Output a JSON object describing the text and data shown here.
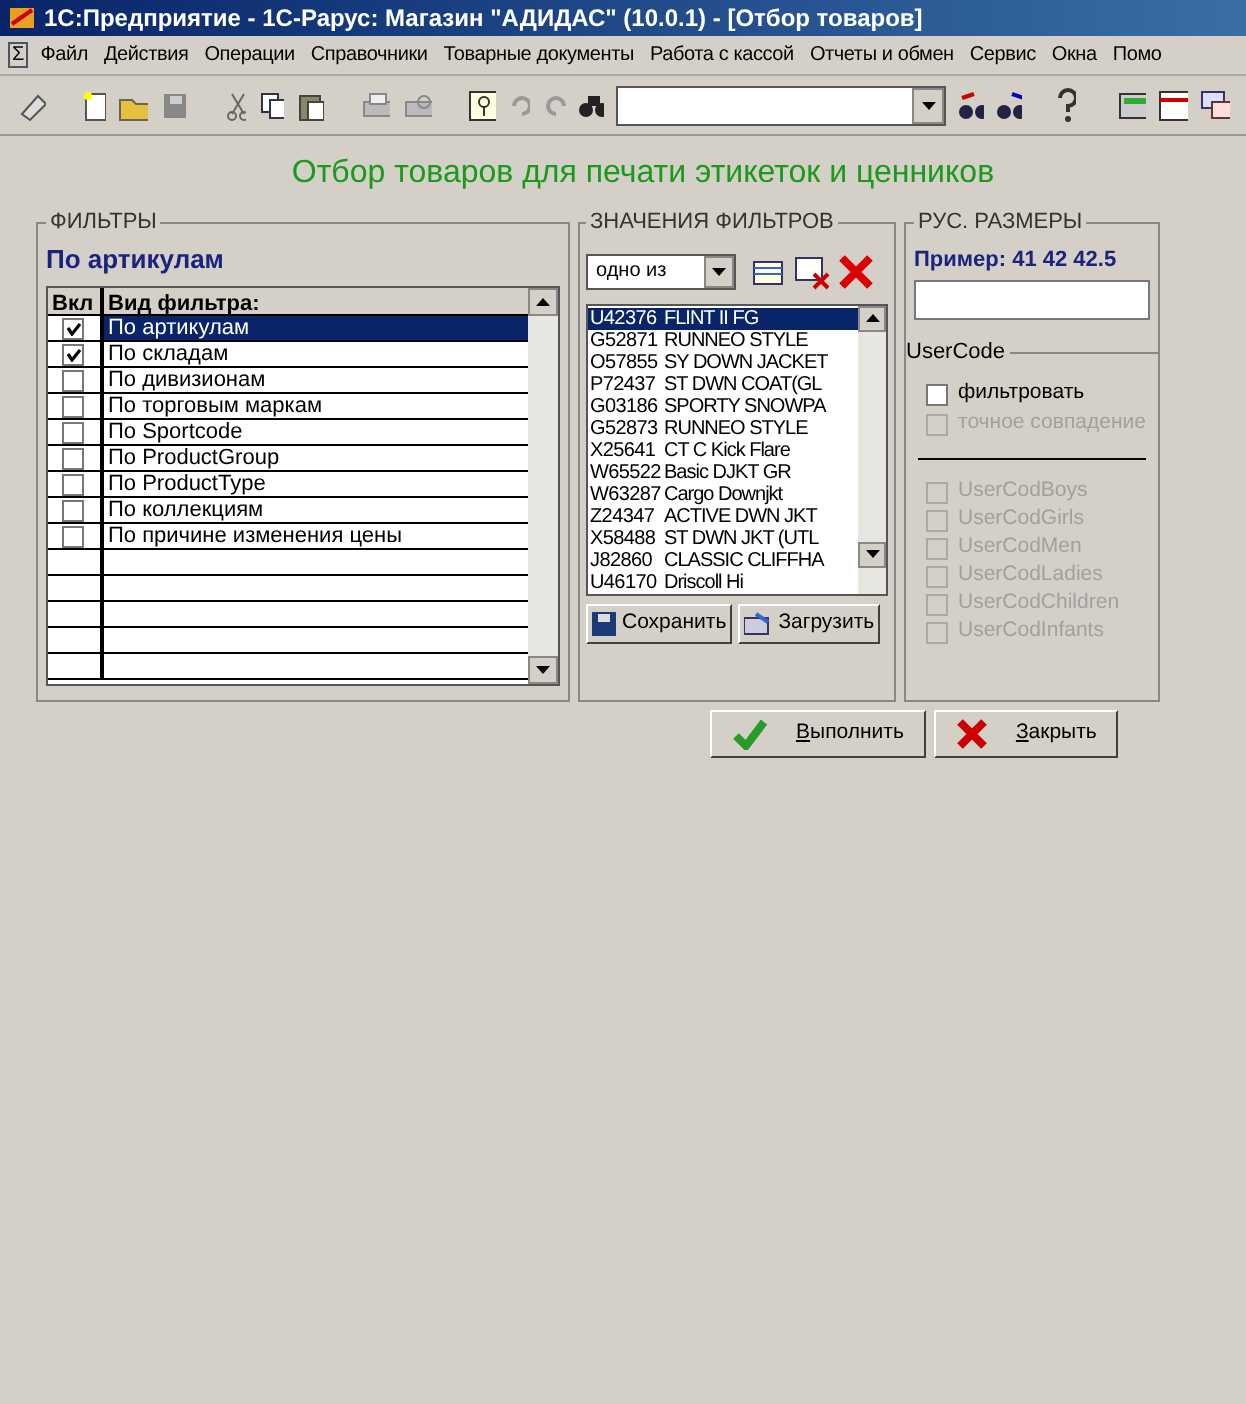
{
  "window": {
    "title": "1С:Предприятие - 1С-Рарус: Магазин \"АДИДАС\" (10.0.1) - [Отбор товаров]"
  },
  "system_menu": "Σ",
  "menu": [
    "Файл",
    "Действия",
    "Операции",
    "Справочники",
    "Товарные документы",
    "Работа с кассой",
    "Отчеты и обмен",
    "Сервис",
    "Окна",
    "Помо"
  ],
  "heading": "Отбор товаров для печати этикеток и ценников",
  "filters": {
    "title": "ФИЛЬТРЫ",
    "current": "По артикулам",
    "columns": [
      "Вкл",
      "Вид фильтра:"
    ],
    "rows": [
      {
        "label": "По артикулам",
        "checked": true,
        "selected": true
      },
      {
        "label": "По складам",
        "checked": true,
        "selected": false
      },
      {
        "label": "По дивизионам",
        "checked": false,
        "selected": false
      },
      {
        "label": "По торговым маркам",
        "checked": false,
        "selected": false
      },
      {
        "label": "По Sportcode",
        "checked": false,
        "selected": false
      },
      {
        "label": "По ProductGroup",
        "checked": false,
        "selected": false
      },
      {
        "label": "По ProductType",
        "checked": false,
        "selected": false
      },
      {
        "label": "По коллекциям",
        "checked": false,
        "selected": false
      },
      {
        "label": "По причине изменения цены",
        "checked": false,
        "selected": false
      }
    ]
  },
  "values": {
    "title": "ЗНАЧЕНИЯ ФИЛЬТРОВ",
    "mode": "одно из",
    "items": [
      {
        "code": "U42376",
        "name": "FLINT II FG",
        "selected": true
      },
      {
        "code": "G52871",
        "name": "RUNNEO STYLE",
        "selected": false
      },
      {
        "code": "O57855",
        "name": "SY DOWN JACKET",
        "selected": false
      },
      {
        "code": "P72437",
        "name": "ST DWN COAT(GL",
        "selected": false
      },
      {
        "code": "G03186",
        "name": "SPORTY SNOWPA",
        "selected": false
      },
      {
        "code": "G52873",
        "name": "RUNNEO STYLE",
        "selected": false
      },
      {
        "code": "X25641",
        "name": "CT C Kick Flare",
        "selected": false
      },
      {
        "code": "W65522",
        "name": "Basic DJKT GR",
        "selected": false
      },
      {
        "code": "W63287",
        "name": "Cargo Downjkt",
        "selected": false
      },
      {
        "code": "Z24347",
        "name": "ACTIVE DWN JKT",
        "selected": false
      },
      {
        "code": "X58488",
        "name": "ST DWN JKT (UTL",
        "selected": false
      },
      {
        "code": "J82860",
        "name": "CLASSIC CLIFFHA",
        "selected": false
      },
      {
        "code": "U46170",
        "name": "Driscoll Hi",
        "selected": false
      }
    ],
    "buttons": [
      "Сохранить",
      "Загрузить"
    ]
  },
  "sizes": {
    "title": "РУС. РАЗМЕРЫ",
    "example": "Пример: 41 42 42.5",
    "usercode_title": "UserCode",
    "options": [
      {
        "label": "фильтровать",
        "checked": false,
        "disabled": false
      },
      {
        "label": "точное совпадение",
        "checked": false,
        "disabled": true
      }
    ],
    "codes": [
      {
        "label": "UserCodBoys",
        "checked": false,
        "disabled": true
      },
      {
        "label": "UserCodGirls",
        "checked": false,
        "disabled": true
      },
      {
        "label": "UserCodMen",
        "checked": false,
        "disabled": true
      },
      {
        "label": "UserCodLadies",
        "checked": false,
        "disabled": true
      },
      {
        "label": "UserCodChildren",
        "checked": false,
        "disabled": true
      },
      {
        "label": "UserCodInfants",
        "checked": false,
        "disabled": true
      }
    ]
  },
  "actions": [
    {
      "label": "Выполнить",
      "kind": "run"
    },
    {
      "label": "Закрыть",
      "kind": "close"
    }
  ]
}
